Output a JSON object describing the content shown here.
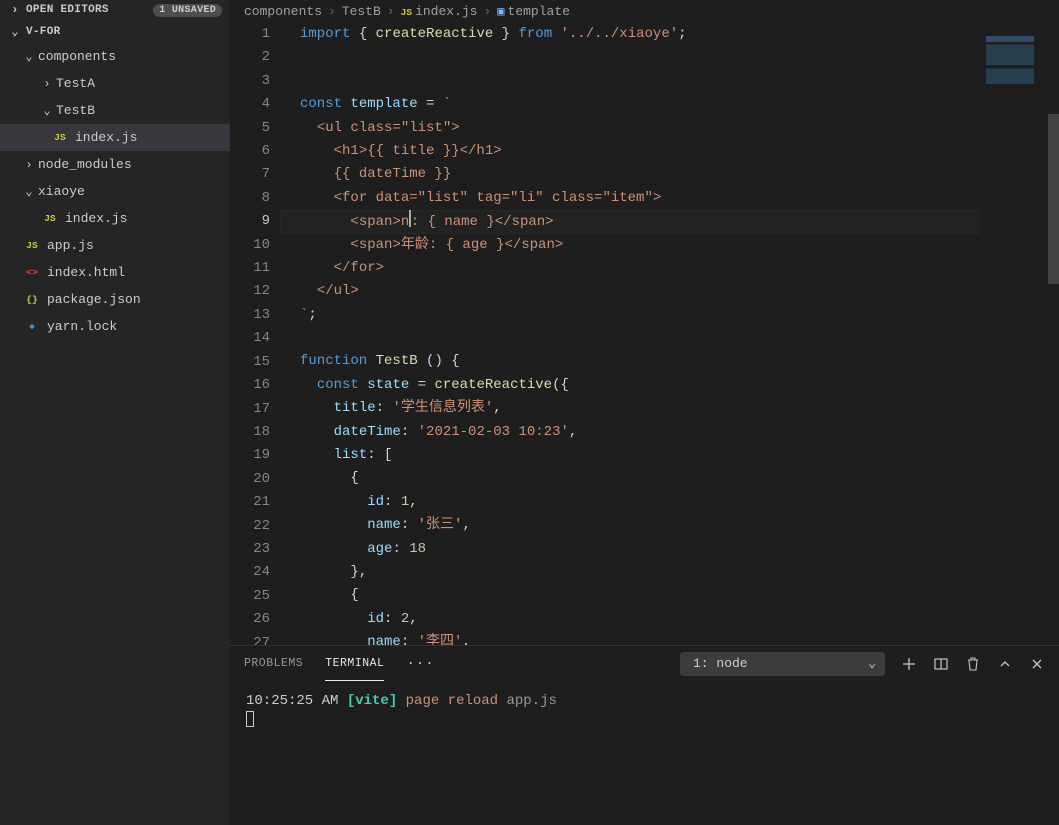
{
  "sidebar": {
    "openEditorsLabel": "OPEN EDITORS",
    "unsaved": "1 UNSAVED",
    "projectName": "V-FOR",
    "tree": [
      {
        "type": "folder",
        "label": "components",
        "open": true,
        "depth": 1
      },
      {
        "type": "folder",
        "label": "TestA",
        "open": false,
        "depth": 2
      },
      {
        "type": "folder",
        "label": "TestB",
        "open": true,
        "depth": 2
      },
      {
        "type": "file",
        "label": "index.js",
        "iconKind": "js",
        "iconText": "JS",
        "depth": 3,
        "active": true
      },
      {
        "type": "folder",
        "label": "node_modules",
        "open": false,
        "depth": 1
      },
      {
        "type": "folder",
        "label": "xiaoye",
        "open": true,
        "depth": 1
      },
      {
        "type": "file",
        "label": "index.js",
        "iconKind": "js",
        "iconText": "JS",
        "depth": 2
      },
      {
        "type": "file",
        "label": "app.js",
        "iconKind": "js",
        "iconText": "JS",
        "depth": 1
      },
      {
        "type": "file",
        "label": "index.html",
        "iconKind": "html",
        "iconText": "<>",
        "depth": 1
      },
      {
        "type": "file",
        "label": "package.json",
        "iconKind": "json",
        "iconText": "{}",
        "depth": 1
      },
      {
        "type": "file",
        "label": "yarn.lock",
        "iconKind": "yarn",
        "iconText": "◆",
        "depth": 1
      }
    ]
  },
  "breadcrumb": {
    "seg0": "components",
    "seg1": "TestB",
    "seg2": "index.js",
    "seg3": "template"
  },
  "editor": {
    "currentLine": 9,
    "lines": [
      {
        "n": 1,
        "html": "<span class='t-keyword'>import</span> <span class='t-punc'>{ </span><span class='t-fn'>createReactive</span><span class='t-punc'> }</span> <span class='t-keyword'>from</span> <span class='t-string'>'../../xiaoye'</span><span class='t-punc'>;</span>"
      },
      {
        "n": 2,
        "html": ""
      },
      {
        "n": 3,
        "html": ""
      },
      {
        "n": 4,
        "html": "<span class='t-storage'>const</span> <span class='t-var'>template</span> <span class='t-punc'>=</span> <span class='t-string'>`</span>"
      },
      {
        "n": 5,
        "html": "  <span class='t-string'>&lt;ul class=\"list\"&gt;</span>"
      },
      {
        "n": 6,
        "html": "    <span class='t-string'>&lt;h1&gt;{{ title }}&lt;/h1&gt;</span>"
      },
      {
        "n": 7,
        "html": "    <span class='t-string'>{{ dateTime }}</span>"
      },
      {
        "n": 8,
        "html": "    <span class='t-string'>&lt;for data=\"list\" tag=\"li\" class=\"item\"&gt;</span>"
      },
      {
        "n": 9,
        "html": "      <span class='t-string'>&lt;span&gt;n</span><span class='cursor'></span><span class='t-string'>: { name }&lt;/span&gt;</span>",
        "current": true
      },
      {
        "n": 10,
        "html": "      <span class='t-string'>&lt;span&gt;年龄: { age }&lt;/span&gt;</span>"
      },
      {
        "n": 11,
        "html": "    <span class='t-string'>&lt;/for&gt;</span>"
      },
      {
        "n": 12,
        "html": "  <span class='t-string'>&lt;/ul&gt;</span>"
      },
      {
        "n": 13,
        "html": "<span class='t-string'>`</span><span class='t-punc'>;</span>"
      },
      {
        "n": 14,
        "html": ""
      },
      {
        "n": 15,
        "html": "<span class='t-storage'>function</span> <span class='t-fn'>TestB</span> <span class='t-punc'>() {</span>"
      },
      {
        "n": 16,
        "html": "  <span class='t-storage'>const</span> <span class='t-var'>state</span> <span class='t-punc'>=</span> <span class='t-fn'>createReactive</span><span class='t-punc'>({</span>"
      },
      {
        "n": 17,
        "html": "    <span class='t-prop'>title</span><span class='t-punc'>:</span> <span class='t-string'>'学生信息列表'</span><span class='t-punc'>,</span>"
      },
      {
        "n": 18,
        "html": "    <span class='t-prop'>dateTime</span><span class='t-punc'>:</span> <span class='t-string'>'2021-02-03 10:23'</span><span class='t-punc'>,</span>"
      },
      {
        "n": 19,
        "html": "    <span class='t-prop'>list</span><span class='t-punc'>: [</span>"
      },
      {
        "n": 20,
        "html": "      <span class='t-punc'>{</span>"
      },
      {
        "n": 21,
        "html": "        <span class='t-prop'>id</span><span class='t-punc'>:</span> <span class='t-num'>1</span><span class='t-punc'>,</span>"
      },
      {
        "n": 22,
        "html": "        <span class='t-prop'>name</span><span class='t-punc'>:</span> <span class='t-string'>'张三'</span><span class='t-punc'>,</span>"
      },
      {
        "n": 23,
        "html": "        <span class='t-prop'>age</span><span class='t-punc'>:</span> <span class='t-num'>18</span>"
      },
      {
        "n": 24,
        "html": "      <span class='t-punc'>},</span>"
      },
      {
        "n": 25,
        "html": "      <span class='t-punc'>{</span>"
      },
      {
        "n": 26,
        "html": "        <span class='t-prop'>id</span><span class='t-punc'>:</span> <span class='t-num'>2</span><span class='t-punc'>,</span>"
      },
      {
        "n": 27,
        "html": "        <span class='t-prop'>name</span><span class='t-punc'>:</span> <span class='t-string'>'李四'</span><span class='t-punc'>,</span>"
      }
    ]
  },
  "panel": {
    "tabs": {
      "problems": "PROBLEMS",
      "terminal": "TERMINAL"
    },
    "dots": "···",
    "terminalSelect": "1: node",
    "output": {
      "time": "10:25:25 AM",
      "vite": "[vite]",
      "page": "page",
      "reload": "reload",
      "file": "app.js"
    }
  }
}
